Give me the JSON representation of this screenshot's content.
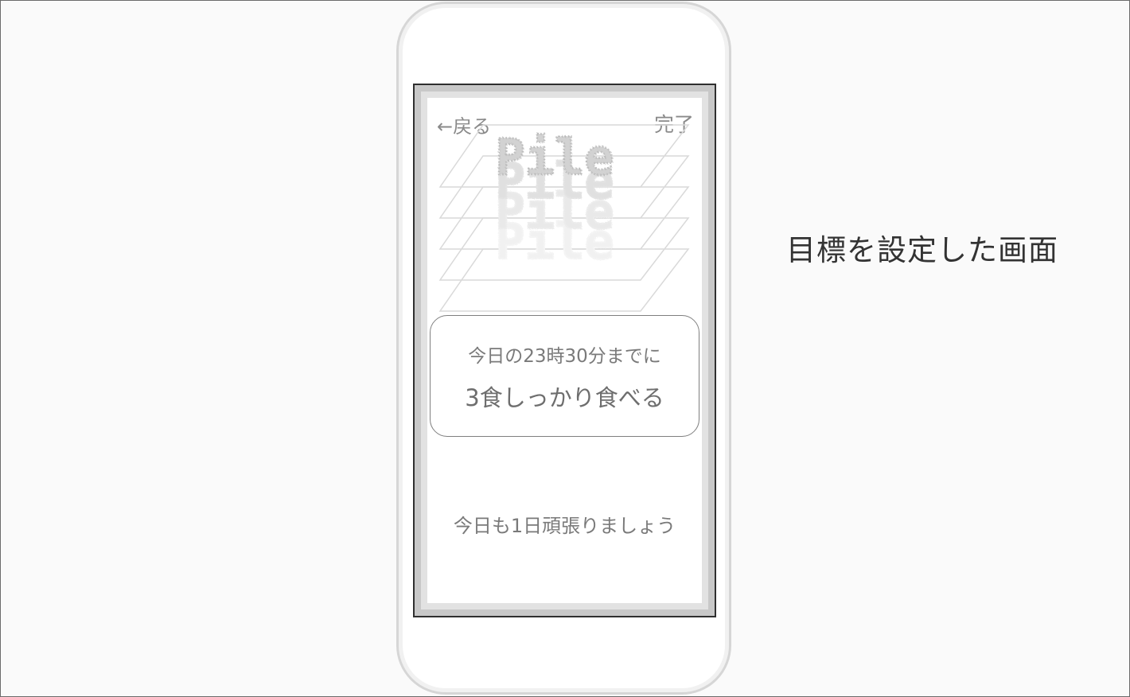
{
  "nav": {
    "back_label": "←戻る",
    "done_label": "完了"
  },
  "logo": {
    "text": "Pile",
    "layer_text": "Pile"
  },
  "goal": {
    "deadline_text": "今日の23時30分までに",
    "goal_text": "3食しっかり食べる"
  },
  "cheer_text": "今日も1日頑張りましょう",
  "caption": "目標を設定した画面",
  "colors": {
    "frame_border": "#2f2f2f",
    "text_gray": "#7a7a7a",
    "phone_outline": "#d6d6d6"
  }
}
